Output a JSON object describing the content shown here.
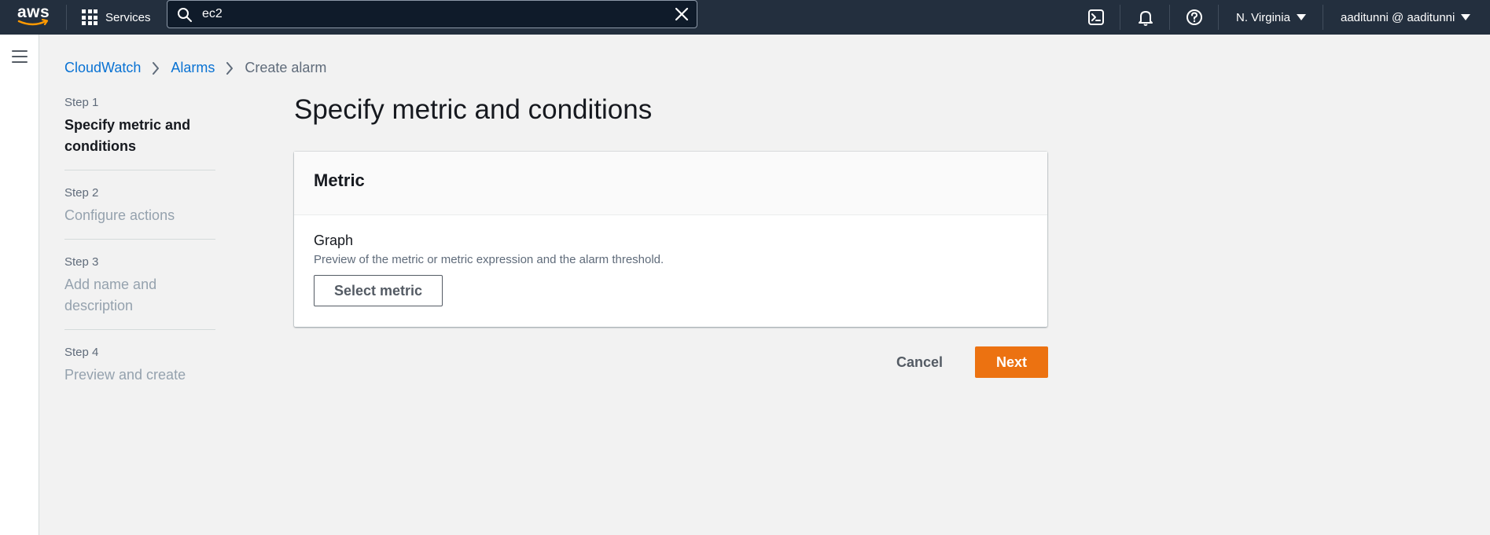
{
  "nav": {
    "logo_text": "aws",
    "services_label": "Services",
    "search_value": "ec2",
    "region_label": "N. Virginia",
    "account_label": "aaditunni @ aaditunni"
  },
  "breadcrumb": {
    "items": [
      "CloudWatch",
      "Alarms"
    ],
    "current": "Create alarm"
  },
  "steps": [
    {
      "number": "Step 1",
      "title": "Specify metric and conditions",
      "active": true
    },
    {
      "number": "Step 2",
      "title": "Configure actions",
      "active": false
    },
    {
      "number": "Step 3",
      "title": "Add name and description",
      "active": false
    },
    {
      "number": "Step 4",
      "title": "Preview and create",
      "active": false
    }
  ],
  "main": {
    "title": "Specify metric and conditions",
    "card": {
      "header": "Metric",
      "field_label": "Graph",
      "field_description": "Preview of the metric or metric expression and the alarm threshold.",
      "select_metric_label": "Select metric"
    },
    "cancel_label": "Cancel",
    "next_label": "Next"
  },
  "colors": {
    "nav_bg": "#232f3e",
    "link": "#0972d3",
    "primary": "#ec7211",
    "page_bg": "#f2f2f2"
  }
}
